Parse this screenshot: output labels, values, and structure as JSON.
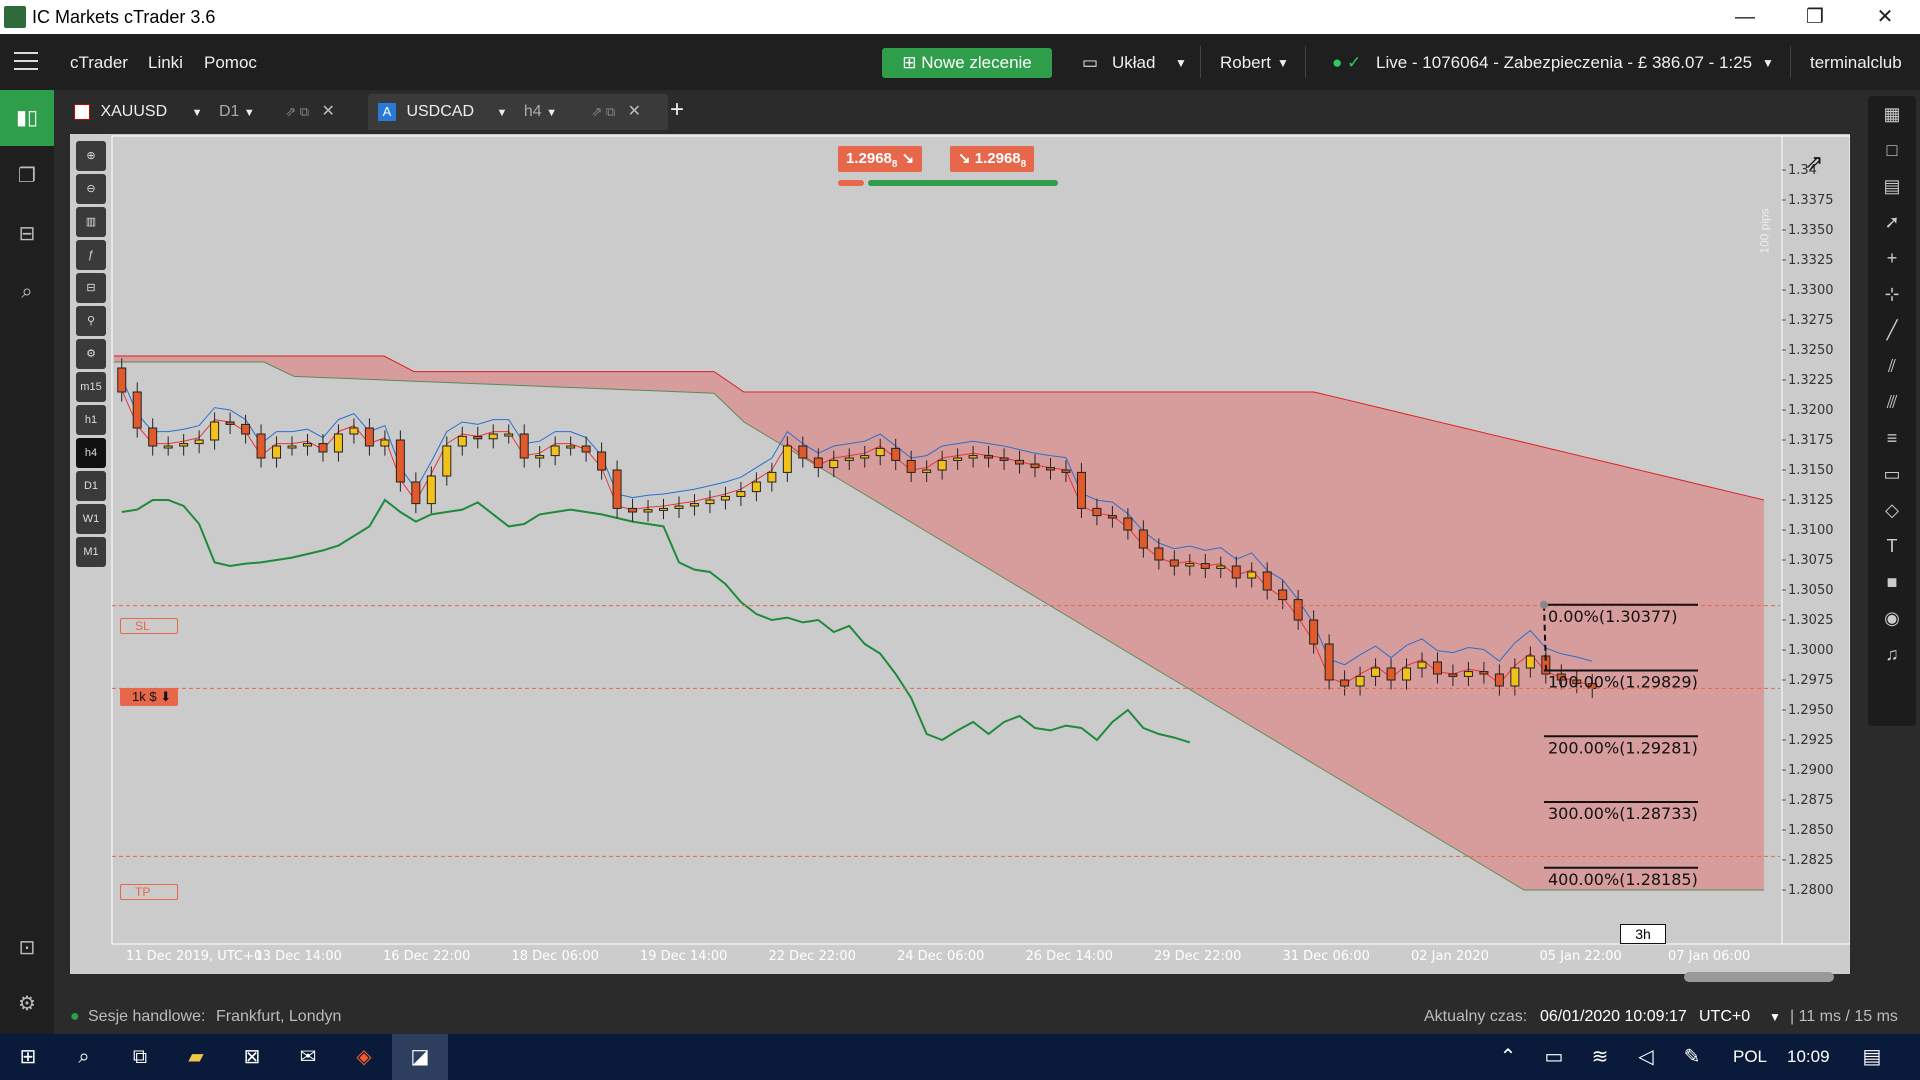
{
  "window": {
    "title": "IC Markets cTrader 3.6",
    "minimize": "—",
    "restore": "❐",
    "close": "✕"
  },
  "menu": {
    "items": [
      "cTrader",
      "Linki",
      "Pomoc"
    ],
    "new_order": "Nowe zlecenie",
    "layout": "Układ",
    "user": "Robert",
    "account": "Live  - 1076064 - Zabezpieczenia - £ 386.07 - 1:25",
    "broker": "terminalclub"
  },
  "tabs": [
    {
      "symbol": "XAUUSD",
      "timeframe": "D1"
    },
    {
      "symbol": "USDCAD",
      "timeframe": "h4",
      "badge": "A"
    }
  ],
  "trade": {
    "sell_price": "1.2968",
    "sell_pip": "8",
    "buy_price": "1.2968",
    "buy_pip": "8"
  },
  "left_tools": [
    "m15",
    "h1",
    "h4",
    "D1",
    "W1",
    "M1"
  ],
  "markers": {
    "sl": "SL",
    "tp": "TP",
    "position": "1k $"
  },
  "ruler": "100 pips",
  "chart_data": {
    "type": "candlestick",
    "symbol": "USDCAD",
    "timeframe": "h4",
    "y_ticks": [
      "1.34",
      "1.3375",
      "1.3350",
      "1.3325",
      "1.3300",
      "1.3275",
      "1.3250",
      "1.3225",
      "1.3200",
      "1.3175",
      "1.3150",
      "1.3125",
      "1.3100",
      "1.3075",
      "1.3050",
      "1.3025",
      "1.3000",
      "1.2975",
      "1.2950",
      "1.2925",
      "1.2900",
      "1.2875",
      "1.2850",
      "1.2825",
      "1.2800"
    ],
    "x_ticks": [
      "11 Dec 2019, UTC+0",
      "13 Dec 14:00",
      "16 Dec 22:00",
      "18 Dec 06:00",
      "19 Dec 14:00",
      "22 Dec 22:00",
      "24 Dec 06:00",
      "26 Dec 14:00",
      "29 Dec 22:00",
      "31 Dec 06:00",
      "02 Jan 2020",
      "05 Jan 22:00",
      "07 Jan 06:00"
    ],
    "fib": [
      {
        "label": "0.00%(1.30377)",
        "price": 1.30377
      },
      {
        "label": "100.00%(1.29829)",
        "price": 1.29829
      },
      {
        "label": "200.00%(1.29281)",
        "price": 1.29281
      },
      {
        "label": "300.00%(1.28733)",
        "price": 1.28733
      },
      {
        "label": "400.00%(1.28185)",
        "price": 1.28185
      }
    ],
    "timer": "3h",
    "closes": [
      1.3215,
      1.3185,
      1.317,
      1.317,
      1.3172,
      1.3175,
      1.319,
      1.3188,
      1.318,
      1.316,
      1.317,
      1.317,
      1.3172,
      1.3165,
      1.318,
      1.3185,
      1.317,
      1.3175,
      1.314,
      1.3122,
      1.3145,
      1.317,
      1.3178,
      1.3176,
      1.318,
      1.318,
      1.316,
      1.3162,
      1.317,
      1.317,
      1.3165,
      1.315,
      1.3118,
      1.3115,
      1.3117,
      1.3118,
      1.312,
      1.3122,
      1.3125,
      1.3128,
      1.3132,
      1.314,
      1.3148,
      1.317,
      1.316,
      1.3152,
      1.3158,
      1.316,
      1.3162,
      1.3168,
      1.3158,
      1.3148,
      1.315,
      1.3158,
      1.316,
      1.3162,
      1.316,
      1.3158,
      1.3155,
      1.3152,
      1.315,
      1.3148,
      1.3118,
      1.3112,
      1.311,
      1.31,
      1.3085,
      1.3075,
      1.307,
      1.3072,
      1.3068,
      1.307,
      1.306,
      1.3065,
      1.305,
      1.3042,
      1.3025,
      1.3005,
      1.2975,
      1.297,
      1.2978,
      1.2985,
      1.2975,
      1.2985,
      1.299,
      1.298,
      1.2978,
      1.2982,
      1.298,
      1.297,
      1.2985,
      1.2995,
      1.298,
      1.2975,
      1.2972,
      1.2968
    ]
  },
  "status": {
    "sessions_label": "Sesje handlowe:",
    "sessions": "Frankfurt, Londyn",
    "time_label": "Aktualny czas:",
    "time": "06/01/2020 10:09:17",
    "tz": "UTC+0",
    "latency": "| 11 ms / 15 ms"
  },
  "taskbar": {
    "lang": "POL",
    "clock": "10:09"
  }
}
